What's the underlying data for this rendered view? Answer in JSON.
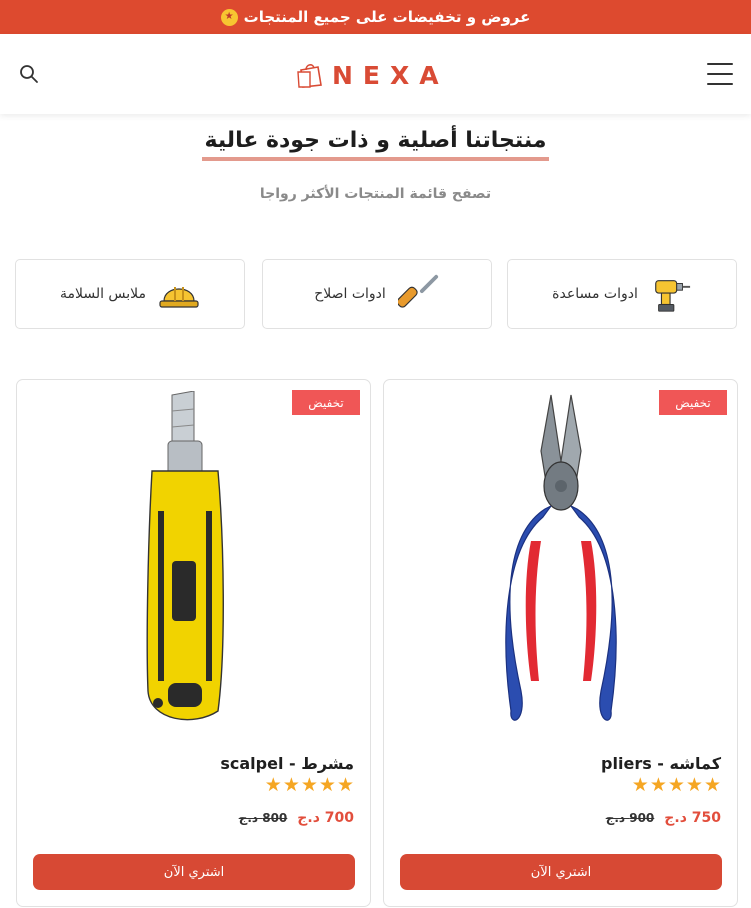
{
  "promo": {
    "text": "عروض و تخفيضات على جميع المنتجات",
    "emoji_icon": "star-struck-emoji-icon"
  },
  "header": {
    "logo_text": "NEXA",
    "menu_icon": "hamburger-menu-icon",
    "search_icon": "search-icon"
  },
  "section": {
    "title": "منتجاتنا أصلية و ذات جودة عالية",
    "subtitle": "تصفح قائمة المنتجات الأكثر رواجا"
  },
  "categories": [
    {
      "label": "ادوات مساعدة",
      "icon": "power-drill-icon"
    },
    {
      "label": "ادوات اصلاح",
      "icon": "screwdriver-icon"
    },
    {
      "label": "ملابس السلامة",
      "icon": "hard-hat-icon"
    }
  ],
  "products": [
    {
      "name": "كماشه - pliers",
      "badge": "تخفيض",
      "price_new": "750 د.ج",
      "price_old": "900 د.ج",
      "rating": 5,
      "rating_max": 5,
      "buy_label": "اشتري الآن",
      "image_icon": "pliers-icon"
    },
    {
      "name": "مشرط - scalpel",
      "badge": "تخفيض",
      "price_new": "700 د.ج",
      "price_old": "800 د.ج",
      "rating": 5,
      "rating_max": 5,
      "buy_label": "اشتري الآن",
      "image_icon": "utility-knife-icon"
    }
  ],
  "colors": {
    "accent": "#dd4a2f",
    "badge": "#f05656",
    "star": "#f5a623",
    "underline": "#e39a8d"
  }
}
